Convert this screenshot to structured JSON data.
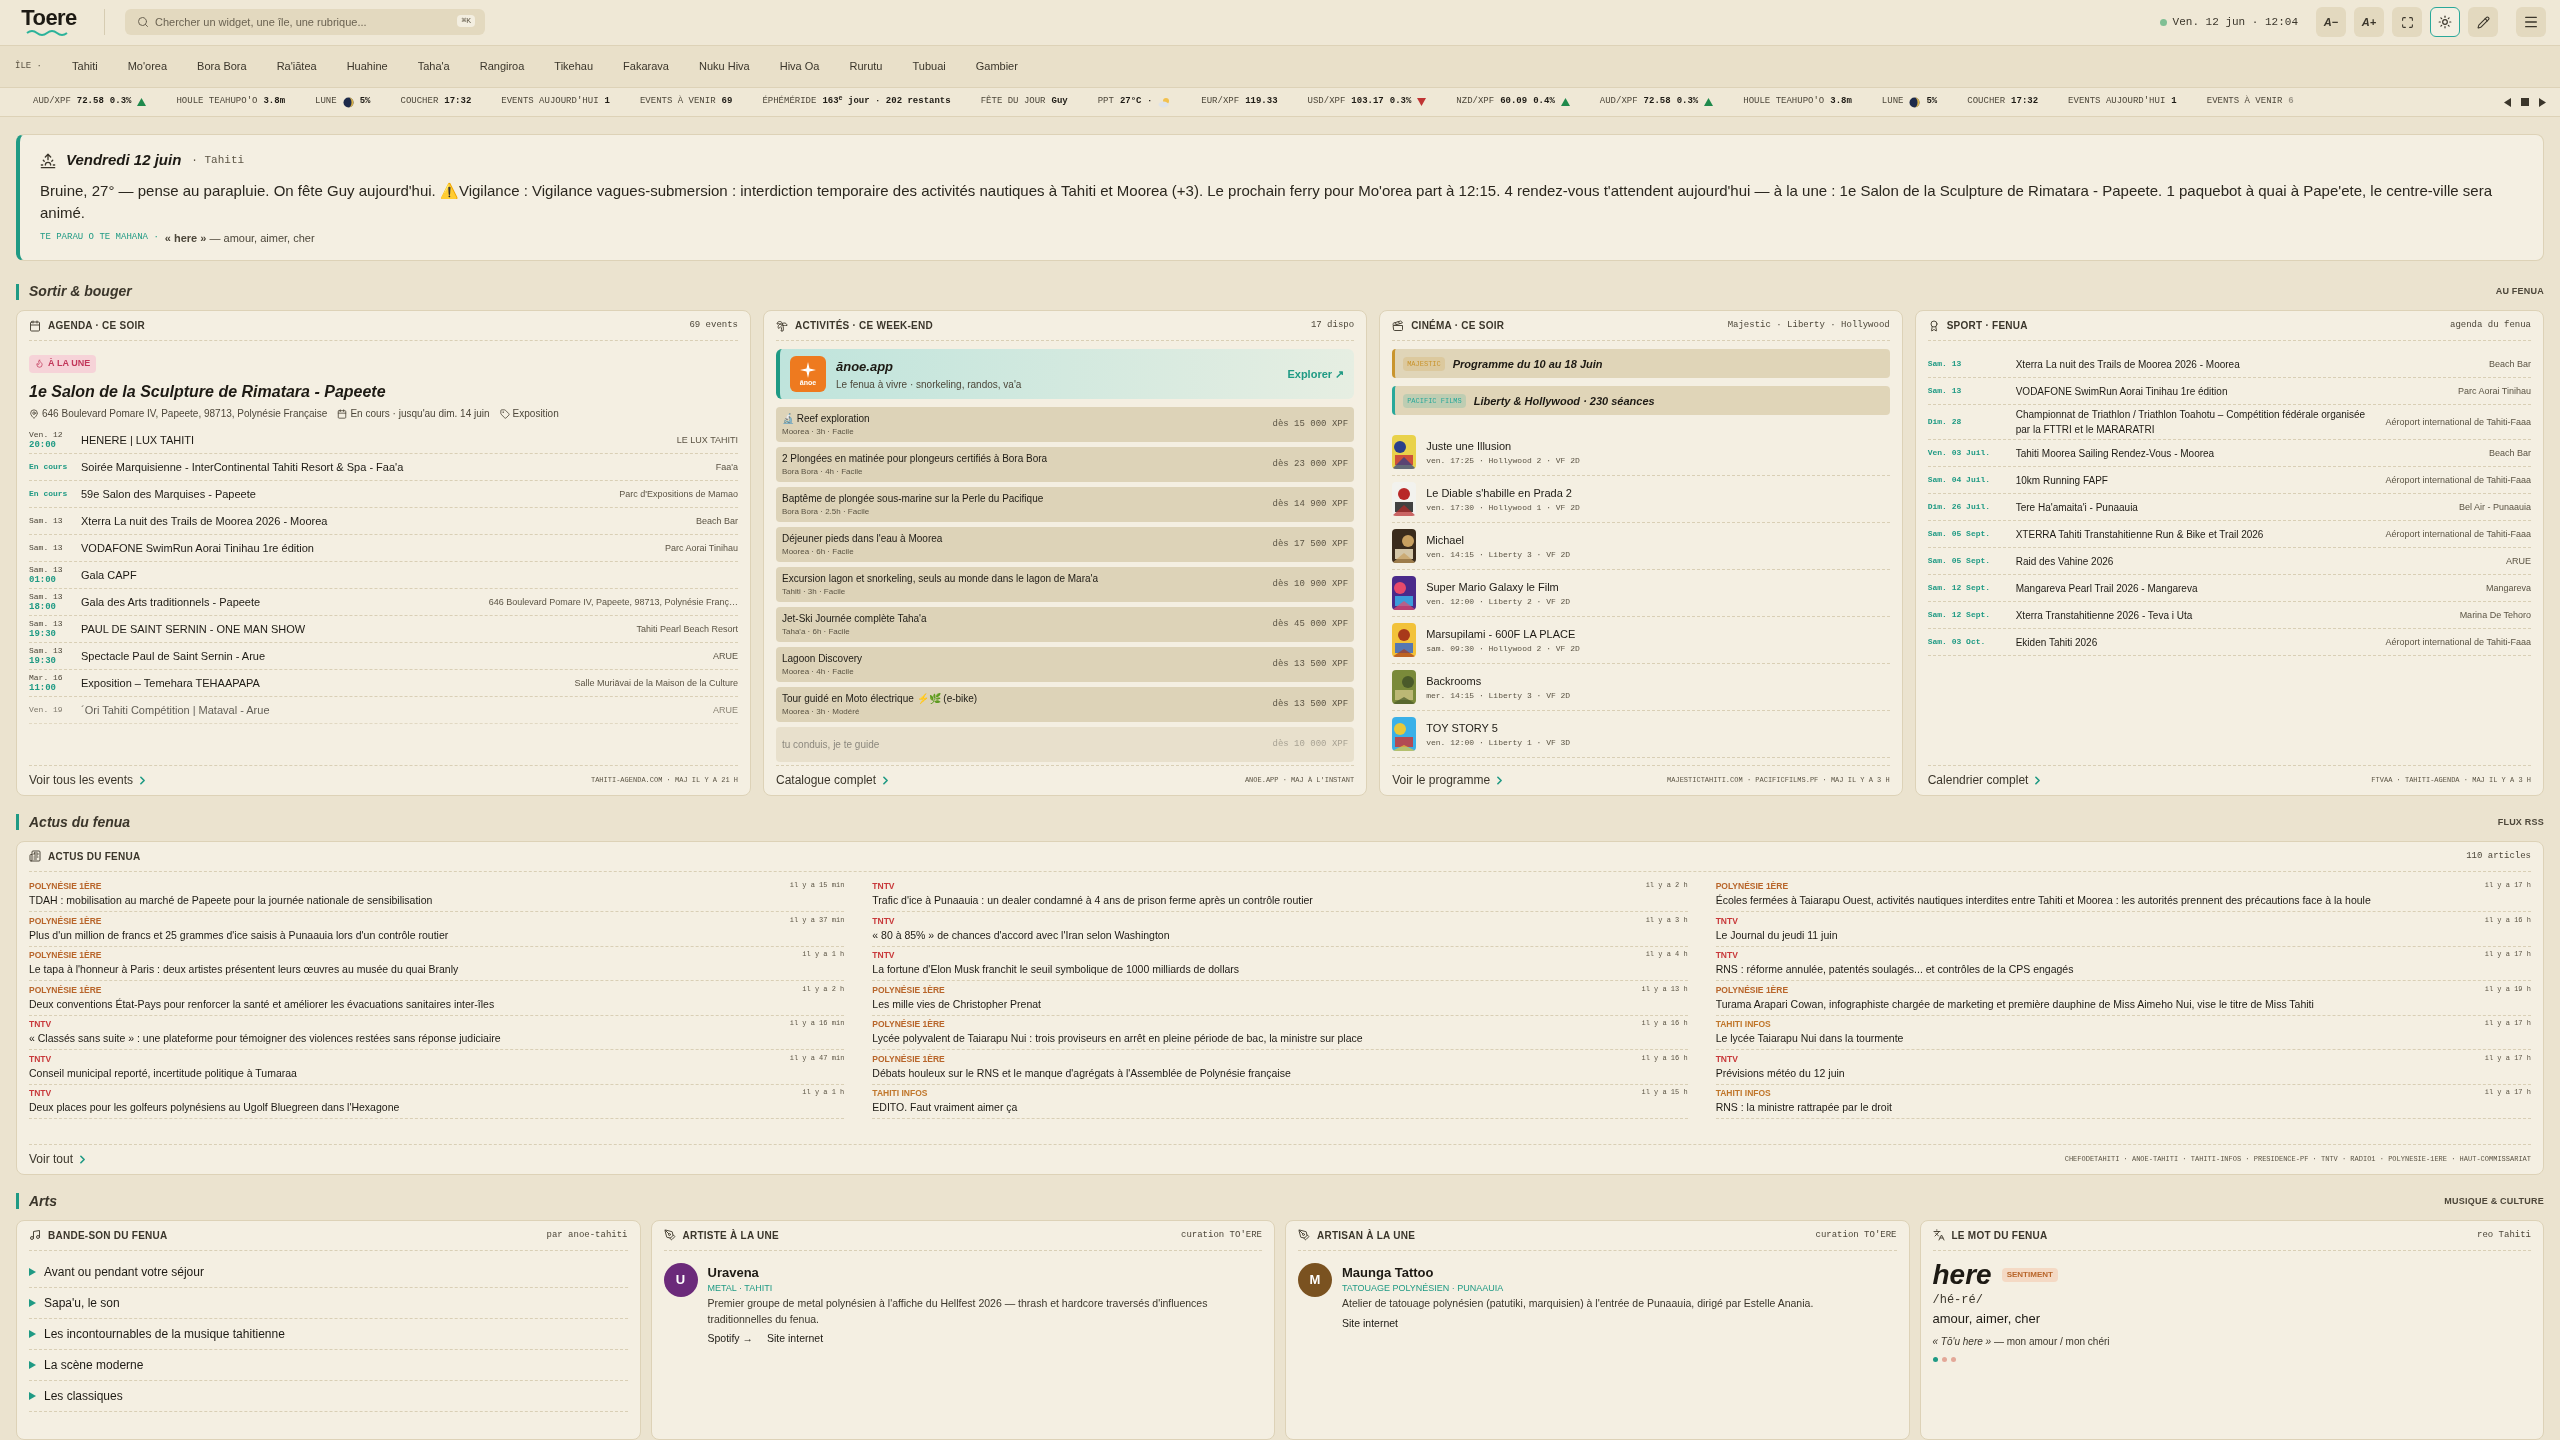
{
  "header": {
    "logo": "Toere",
    "search": {
      "placeholder": "Chercher un widget, une île, une rubrique...",
      "shortcut": "⌘K"
    },
    "clock": "Ven. 12 jun · 12:04",
    "buttons": [
      {
        "kind": "text",
        "label": "A−",
        "selected": false
      },
      {
        "kind": "text",
        "label": "A+",
        "selected": false
      },
      {
        "kind": "fullscreen",
        "selected": false
      },
      {
        "kind": "theme",
        "selected": true
      },
      {
        "kind": "edit",
        "selected": false
      },
      {
        "kind": "menu",
        "selected": false
      }
    ]
  },
  "islands": {
    "label": "ÎLE ·",
    "items": [
      {
        "label": "Tahiti",
        "selected": false
      },
      {
        "label": "Mo'orea",
        "selected": false
      },
      {
        "label": "Bora Bora",
        "selected": false
      },
      {
        "label": "Ra'iātea",
        "selected": false
      },
      {
        "label": "Huahine",
        "selected": false
      },
      {
        "label": "Taha'a",
        "selected": false
      },
      {
        "label": "Rangiroa",
        "selected": false
      },
      {
        "label": "Tikehau",
        "selected": false
      },
      {
        "label": "Fakarava",
        "selected": false
      },
      {
        "label": "Nuku Hiva",
        "selected": false
      },
      {
        "label": "Hiva Oa",
        "selected": false
      },
      {
        "label": "Rurutu",
        "selected": false
      },
      {
        "label": "Tubuai",
        "selected": false
      },
      {
        "label": "Gambier",
        "selected": false
      }
    ]
  },
  "ticker": [
    {
      "label": "AUD/XPF",
      "value": "72.58",
      "change": "0.3%",
      "rising": true
    },
    {
      "label": "HOULE TEAHUPO'O",
      "value": "3.8m"
    },
    {
      "label": "LUNE",
      "value": "5%",
      "kind": "moon"
    },
    {
      "label": "COUCHER",
      "value": "17:32"
    },
    {
      "label": "EVENTS AUJOURD'HUI",
      "value": "1"
    },
    {
      "label": "EVENTS À VENIR",
      "value": "69"
    },
    {
      "label": "ÉPHÉMÉRIDE",
      "value": "163$^{e}$ jour · 202 restants"
    },
    {
      "label": "FÊTE DU JOUR",
      "value": "Guy"
    },
    {
      "label": "PPT",
      "value": "27°C ·",
      "kind": "weather"
    },
    {
      "label": "EUR/XPF",
      "value": "119.33"
    },
    {
      "label": "USD/XPF",
      "value": "103.17",
      "change": "0.3%",
      "rising": false
    },
    {
      "label": "NZD/XPF",
      "value": "60.09",
      "change": "0.4%",
      "rising": true
    },
    {
      "label": "AUD/XPF",
      "value": "72.58",
      "change": "0.3%",
      "rising": true
    },
    {
      "label": "HOULE TEAHUPO'O",
      "value": "3.8m"
    },
    {
      "label": "LUNE",
      "value": "5%",
      "kind": "moon"
    },
    {
      "label": "COUCHER",
      "value": "17:32"
    },
    {
      "label": "EVENTS AUJOURD'HUI",
      "value": "1"
    },
    {
      "label": "EVENTS À VENIR",
      "value": "6"
    }
  ],
  "briefing": {
    "title": "Vendredi 12 juin",
    "place": "· Tahiti",
    "text": "Bruine, 27° — pense au parapluie. On fête Guy aujourd'hui. ⚠️Vigilance : Vigilance vagues-submersion : interdiction temporaire des activités nautiques à Tahiti et Moorea (+3). Le prochain ferry pour Mo'orea part à 12:15. 4 rendez-vous t'attendent aujourd'hui — à la une : 1e Salon de la Sculpture de Rimatara - Papeete. 1 paquebot à quai à Pape'ete, le centre-ville sera animé.",
    "word_label": "TE PARAU O TE MAHANA ·",
    "word": "**« here »** — amour, aimer, cher"
  },
  "sections": [
    {
      "title": "Sortir & bouger",
      "aside": "AU FENUA"
    },
    {
      "title": "Actus du fenua",
      "aside": "FLUX RSS"
    },
    {
      "title": "Arts",
      "aside": "MUSIQUE & CULTURE"
    }
  ],
  "agenda": {
    "title": "AGENDA · CE SOIR",
    "count": "69 events",
    "badge": "À LA UNE",
    "featured": {
      "title": "1e Salon de la Sculpture de Rimatara - Papeete",
      "address": "646 Boulevard Pomare IV, Papeete, 98713, Polynésie Française",
      "status": "En cours · jusqu'au dim. 14 juin",
      "category": "Exposition"
    },
    "rows": [
      {
        "when": "Ven. 12",
        "time": "20:00",
        "live": false,
        "title": "HENERE | LUX TAHITI",
        "place": "LE LUX TAHITI"
      },
      {
        "when": "En cours",
        "live": true,
        "title": "Soirée Marquisienne - InterContinental Tahiti Resort & Spa - Faa'a",
        "place": "Faa'a"
      },
      {
        "when": "En cours",
        "live": true,
        "title": "59e Salon des Marquises - Papeete",
        "place": "Parc d'Expositions de Mamao"
      },
      {
        "when": "Sam. 13",
        "live": false,
        "title": "Xterra La nuit des Trails de Moorea 2026 - Moorea",
        "place": "Beach Bar"
      },
      {
        "when": "Sam. 13",
        "live": false,
        "title": "VODAFONE SwimRun Aorai Tinihau 1re édition",
        "place": "Parc Aorai Tinihau"
      },
      {
        "when": "Sam. 13",
        "time": "01:00",
        "live": false,
        "title": "Gala CAPF"
      },
      {
        "when": "Sam. 13",
        "time": "18:00",
        "live": false,
        "title": "Gala des Arts traditionnels - Papeete",
        "place": "646 Boulevard Pomare IV, Papeete, 98713, Polynésie Franç…"
      },
      {
        "when": "Sam. 13",
        "time": "19:30",
        "live": false,
        "title": "PAUL DE SAINT SERNIN - ONE MAN SHOW",
        "place": "Tahiti Pearl Beach Resort"
      },
      {
        "when": "Sam. 13",
        "time": "19:30",
        "live": false,
        "title": "Spectacle Paul de Saint Sernin - Arue",
        "place": "ARUE"
      },
      {
        "when": "Mar. 16",
        "time": "11:00",
        "live": false,
        "title": "Exposition – Temehara TEHAAPAPA",
        "place": "Salle Muriāvai de la Maison de la Culture"
      },
      {
        "when": "Ven. 19",
        "live": false,
        "title": "´Ori Tahiti Compétition | Mataval - Arue",
        "place": "ARUE"
      }
    ],
    "link": "Voir tous les events",
    "source": "TAHITI-AGENDA.COM · MAJ IL Y A 21 H"
  },
  "activities": {
    "title": "ACTIVITÉS · CE WEEK-END",
    "count": "17 dispo",
    "promo": {
      "logo_text": "ānoe",
      "name": "ānoe.app",
      "tagline": "Le fenua à vivre · snorkeling, randos, va'a",
      "link": "Explorer ↗"
    },
    "items": [
      {
        "title": "🔬 Reef exploration",
        "meta": "Moorea · 3h · Facile",
        "price": "dès 15 000 XPF"
      },
      {
        "title": "2 Plongées en matinée pour plongeurs certifiés à Bora Bora",
        "meta": "Bora Bora · 4h · Facile",
        "price": "dès 23 000 XPF"
      },
      {
        "title": "Baptême de plongée sous-marine sur la Perle du Pacifique",
        "meta": "Bora Bora · 2.5h · Facile",
        "price": "dès 14 900 XPF"
      },
      {
        "title": "Déjeuner pieds dans l'eau à Moorea",
        "meta": "Moorea · 6h · Facile",
        "price": "dès 17 500 XPF"
      },
      {
        "title": "Excursion lagon et snorkeling, seuls au monde dans le lagon de Mara'a",
        "meta": "Tahiti · 3h · Facile",
        "price": "dès 10 900 XPF"
      },
      {
        "title": "Jet-Ski Journée complète Taha'a",
        "meta": "Taha'a · 6h · Facile",
        "price": "dès 45 000 XPF"
      },
      {
        "title": "Lagoon Discovery",
        "meta": "Moorea · 4h · Facile",
        "price": "dès 13 500 XPF"
      },
      {
        "title": "Tour guidé en Moto électrique ⚡🌿 (e-bike)",
        "meta": "Moorea · 3h · Modéré",
        "price": "dès 13 500 XPF"
      },
      {
        "title": "tu conduis, je te guide",
        "price": "dès 10 000 XPF"
      }
    ],
    "link": "Catalogue complet",
    "source": "ANOE.APP · MAJ À L'INSTANT"
  },
  "cinema": {
    "title": "CINÉMA · CE SOIR",
    "venues": "Majestic · Liberty · Hollywood",
    "banners": [
      {
        "tag": "MAJESTIC",
        "text": "Programme du 10 au 18 Juin",
        "color": "#c9952e"
      },
      {
        "tag": "PACIFIC FILMS",
        "text": "Liberty & Hollywood · 230 séances",
        "color": "#2aa89a"
      }
    ],
    "movies": [
      {
        "title": "Juste une Illusion",
        "meta": "ven. 17:25 · Hollywood 2 · VF 2D"
      },
      {
        "title": "Le Diable s'habille en Prada 2",
        "meta": "ven. 17:30 · Hollywood 1 · VF 2D"
      },
      {
        "title": "Michael",
        "meta": "ven. 14:15 · Liberty 3 · VF 2D"
      },
      {
        "title": "Super Mario Galaxy le Film",
        "meta": "ven. 12:00 · Liberty 2 · VF 2D"
      },
      {
        "title": "Marsupilami - 600F LA PLACE",
        "meta": "sam. 09:30 · Hollywood 2 · VF 2D"
      },
      {
        "title": "Backrooms",
        "meta": "mer. 14:15 · Liberty 3 · VF 2D"
      },
      {
        "title": "TOY STORY 5",
        "meta": "ven. 12:00 · Liberty 1 · VF 3D"
      }
    ],
    "link": "Voir le programme",
    "source": "MAJESTICTAHITI.COM · PACIFICFILMS.PF · MAJ IL Y A 3 H"
  },
  "sport": {
    "title": "SPORT · FENUA",
    "aside": "agenda du fenua",
    "rows": [
      {
        "date": "Sam. 13",
        "title": "Xterra La nuit des Trails de Moorea 2026 - Moorea",
        "place": "Beach Bar"
      },
      {
        "date": "Sam. 13",
        "title": "VODAFONE SwimRun Aorai Tinihau 1re édition",
        "place": "Parc Aorai Tinihau"
      },
      {
        "date": "Dim. 28",
        "title": "Championnat de Triathlon / Triathlon Toahotu – Compétition fédérale organisée par la FTTRI et le MARARATRI",
        "place": "Aéroport international de Tahiti-Faaa"
      },
      {
        "date": "Ven. 03 Juil.",
        "title": "Tahiti Moorea Sailing Rendez-Vous - Moorea",
        "place": "Beach Bar"
      },
      {
        "date": "Sam. 04 Juil.",
        "title": "10km Running FAPF",
        "place": "Aéroport international de Tahiti-Faaa"
      },
      {
        "date": "Dim. 26 Juil.",
        "title": "Tere Ha'amaita'i - Punaauia",
        "place": "Bel Air - Punaauia"
      },
      {
        "date": "Sam. 05 Sept.",
        "title": "XTERRA Tahiti Transtahitienne Run & Bike et Trail 2026",
        "place": "Aéroport international de Tahiti-Faaa"
      },
      {
        "date": "Sam. 05 Sept.",
        "title": "Raid des Vahine 2026",
        "place": "ARUE"
      },
      {
        "date": "Sam. 12 Sept.",
        "title": "Mangareva Pearl Trail 2026 - Mangareva",
        "place": "Mangareva"
      },
      {
        "date": "Sam. 12 Sept.",
        "title": "Xterra Transtahitienne 2026 - Teva i Uta",
        "place": "Marina De Tehoro"
      },
      {
        "date": "Sam. 03 Oct.",
        "title": "Ekiden Tahiti 2026",
        "place": "Aéroport international de Tahiti-Faaa"
      }
    ],
    "link": "Calendrier complet",
    "source": "FTVAA · TAHITI-AGENDA · MAJ IL Y A 3 H"
  },
  "news": {
    "title": "ACTUS DU FENUA",
    "count": "110 articles",
    "columns": [
      [
        {
          "source": "POLYNÉSIE 1ÈRE",
          "color": "#b8652a",
          "age": "il y a 15 min",
          "title": "TDAH : mobilisation au marché de Papeete pour la journée nationale de sensibilisation"
        },
        {
          "source": "POLYNÉSIE 1ÈRE",
          "color": "#b8652a",
          "age": "il y a 37 min",
          "title": "Plus d'un million de francs et 25 grammes d'ice saisis à Punaauia lors d'un contrôle routier"
        },
        {
          "source": "POLYNÉSIE 1ÈRE",
          "color": "#b8652a",
          "age": "il y a 1 h",
          "title": "Le tapa à l'honneur à Paris : deux artistes présentent leurs œuvres au musée du quai Branly"
        },
        {
          "source": "POLYNÉSIE 1ÈRE",
          "color": "#b8652a",
          "age": "il y a 2 h",
          "title": "Deux conventions État-Pays pour renforcer la santé et améliorer les évacuations sanitaires inter-îles"
        },
        {
          "source": "TNTV",
          "color": "#c8383a",
          "age": "il y a 16 min",
          "title": "« Classés sans suite » : une plateforme pour témoigner des violences restées sans réponse judiciaire"
        },
        {
          "source": "TNTV",
          "color": "#c8383a",
          "age": "il y a 47 min",
          "title": "Conseil municipal reporté, incertitude politique à Tumaraa"
        },
        {
          "source": "TNTV",
          "color": "#c8383a",
          "age": "il y a 1 h",
          "title": "Deux places pour les golfeurs polynésiens au Ugolf Bluegreen dans l'Hexagone"
        }
      ],
      [
        {
          "source": "TNTV",
          "color": "#c8383a",
          "age": "il y a 2 h",
          "title": "Trafic d'ice à Punaauia : un dealer condamné à 4 ans de prison ferme après un contrôle routier"
        },
        {
          "source": "TNTV",
          "color": "#c8383a",
          "age": "il y a 3 h",
          "title": "« 80 à 85% » de chances d'accord avec l'Iran selon Washington"
        },
        {
          "source": "TNTV",
          "color": "#c8383a",
          "age": "il y a 4 h",
          "title": "La fortune d'Elon Musk franchit le seuil symbolique de 1000 milliards de dollars"
        },
        {
          "source": "POLYNÉSIE 1ÈRE",
          "color": "#b8652a",
          "age": "il y a 13 h",
          "title": "Les mille vies de Christopher Prenat"
        },
        {
          "source": "POLYNÉSIE 1ÈRE",
          "color": "#b8652a",
          "age": "il y a 16 h",
          "title": "Lycée polyvalent de Taiarapu Nui : trois proviseurs en arrêt en pleine période de bac, la ministre sur place"
        },
        {
          "source": "POLYNÉSIE 1ÈRE",
          "color": "#b8652a",
          "age": "il y a 16 h",
          "title": "Débats houleux sur le RNS et le manque d'agrégats à l'Assemblée de Polynésie française"
        },
        {
          "source": "TAHITI INFOS",
          "color": "#c0762a",
          "age": "il y a 15 h",
          "title": "EDITO. Faut vraiment aimer ça"
        }
      ],
      [
        {
          "source": "POLYNÉSIE 1ÈRE",
          "color": "#b8652a",
          "age": "il y a 17 h",
          "title": "Écoles fermées à Taiarapu Ouest, activités nautiques interdites entre Tahiti et Moorea : les autorités prennent des précautions face à la houle"
        },
        {
          "source": "TNTV",
          "color": "#c8383a",
          "age": "il y a 16 h",
          "title": "Le Journal du jeudi 11 juin"
        },
        {
          "source": "TNTV",
          "color": "#c8383a",
          "age": "il y a 17 h",
          "title": "RNS : réforme annulée, patentés soulagés... et contrôles de la CPS engagés"
        },
        {
          "source": "POLYNÉSIE 1ÈRE",
          "color": "#b8652a",
          "age": "il y a 19 h",
          "title": "Turama Arapari Cowan, infographiste chargée de marketing et première dauphine de Miss Aimeho Nui, vise le titre de Miss Tahiti"
        },
        {
          "source": "TAHITI INFOS",
          "color": "#c0762a",
          "age": "il y a 17 h",
          "title": "Le lycée Taiarapu Nui dans la tourmente"
        },
        {
          "source": "TNTV",
          "color": "#c8383a",
          "age": "il y a 17 h",
          "title": "Prévisions météo du 12 juin"
        },
        {
          "source": "TAHITI INFOS",
          "color": "#c0762a",
          "age": "il y a 17 h",
          "title": "RNS : la ministre rattrapée par le droit"
        }
      ]
    ],
    "link": "Voir tout",
    "source": "CHEFODETAHITI · ANOE-TAHITI · TAHITI-INFOS · PRESIDENCE-PF · TNTV · RADIO1 · POLYNESIE-1ERE · HAUT-COMMISSARIAT"
  },
  "soundtrack": {
    "title": "BANDE-SON DU FENUA",
    "aside": "par anoe-tahiti",
    "items": [
      "Avant ou pendant votre séjour",
      "Sapa'u, le son",
      "Les incontournables de la musique tahitienne",
      "La scène moderne",
      "Les classiques"
    ]
  },
  "artist": {
    "title": "ARTISTE À LA UNE",
    "aside": "curation TO'ERE",
    "initial": "U",
    "color": "#6b2a7a",
    "name": "Uravena",
    "tags": "METAL · TAHITI",
    "description": "Premier groupe de metal polynésien à l'affiche du Hellfest 2026 — thrash et hardcore traversés d'influences traditionnelles du fenua.",
    "links": [
      "Spotify →",
      "Site internet"
    ]
  },
  "artisan": {
    "title": "ARTISAN À LA UNE",
    "aside": "curation TO'ERE",
    "initial": "M",
    "color": "#7a5220",
    "name": "Maunga Tattoo",
    "tags": "TATOUAGE POLYNÉSIEN · PUNAAUIA",
    "description": "Atelier de tatouage polynésien (patutiki, marquisien) à l'entrée de Punaauia, dirigé par Estelle Anania.",
    "links": [
      "Site internet"
    ]
  },
  "word": {
    "title": "LE MOT DU FENUA",
    "aside": "reo Tahiti",
    "word": "here",
    "badge": "SENTIMENT",
    "pronunciation": "/hé-ré/",
    "meaning": "amour, aimer, cher",
    "example": "*« Tō'u here »* — mon amour / mon chéri",
    "dots": [
      {
        "selected": true
      },
      {
        "selected": false
      },
      {
        "selected": false
      }
    ]
  }
}
